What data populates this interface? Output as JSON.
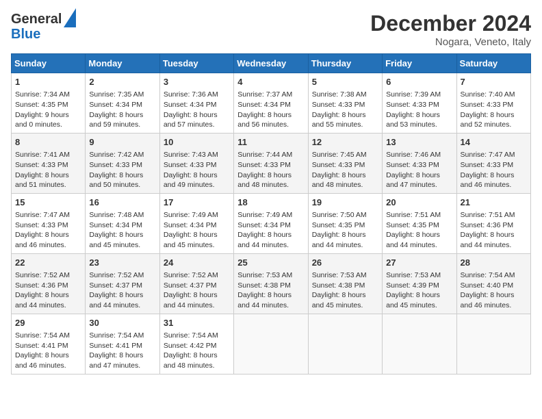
{
  "header": {
    "logo_general": "General",
    "logo_blue": "Blue",
    "month_title": "December 2024",
    "location": "Nogara, Veneto, Italy"
  },
  "days_of_week": [
    "Sunday",
    "Monday",
    "Tuesday",
    "Wednesday",
    "Thursday",
    "Friday",
    "Saturday"
  ],
  "weeks": [
    [
      {
        "day": "1",
        "sunrise": "Sunrise: 7:34 AM",
        "sunset": "Sunset: 4:35 PM",
        "daylight": "Daylight: 9 hours and 0 minutes."
      },
      {
        "day": "2",
        "sunrise": "Sunrise: 7:35 AM",
        "sunset": "Sunset: 4:34 PM",
        "daylight": "Daylight: 8 hours and 59 minutes."
      },
      {
        "day": "3",
        "sunrise": "Sunrise: 7:36 AM",
        "sunset": "Sunset: 4:34 PM",
        "daylight": "Daylight: 8 hours and 57 minutes."
      },
      {
        "day": "4",
        "sunrise": "Sunrise: 7:37 AM",
        "sunset": "Sunset: 4:34 PM",
        "daylight": "Daylight: 8 hours and 56 minutes."
      },
      {
        "day": "5",
        "sunrise": "Sunrise: 7:38 AM",
        "sunset": "Sunset: 4:33 PM",
        "daylight": "Daylight: 8 hours and 55 minutes."
      },
      {
        "day": "6",
        "sunrise": "Sunrise: 7:39 AM",
        "sunset": "Sunset: 4:33 PM",
        "daylight": "Daylight: 8 hours and 53 minutes."
      },
      {
        "day": "7",
        "sunrise": "Sunrise: 7:40 AM",
        "sunset": "Sunset: 4:33 PM",
        "daylight": "Daylight: 8 hours and 52 minutes."
      }
    ],
    [
      {
        "day": "8",
        "sunrise": "Sunrise: 7:41 AM",
        "sunset": "Sunset: 4:33 PM",
        "daylight": "Daylight: 8 hours and 51 minutes."
      },
      {
        "day": "9",
        "sunrise": "Sunrise: 7:42 AM",
        "sunset": "Sunset: 4:33 PM",
        "daylight": "Daylight: 8 hours and 50 minutes."
      },
      {
        "day": "10",
        "sunrise": "Sunrise: 7:43 AM",
        "sunset": "Sunset: 4:33 PM",
        "daylight": "Daylight: 8 hours and 49 minutes."
      },
      {
        "day": "11",
        "sunrise": "Sunrise: 7:44 AM",
        "sunset": "Sunset: 4:33 PM",
        "daylight": "Daylight: 8 hours and 48 minutes."
      },
      {
        "day": "12",
        "sunrise": "Sunrise: 7:45 AM",
        "sunset": "Sunset: 4:33 PM",
        "daylight": "Daylight: 8 hours and 48 minutes."
      },
      {
        "day": "13",
        "sunrise": "Sunrise: 7:46 AM",
        "sunset": "Sunset: 4:33 PM",
        "daylight": "Daylight: 8 hours and 47 minutes."
      },
      {
        "day": "14",
        "sunrise": "Sunrise: 7:47 AM",
        "sunset": "Sunset: 4:33 PM",
        "daylight": "Daylight: 8 hours and 46 minutes."
      }
    ],
    [
      {
        "day": "15",
        "sunrise": "Sunrise: 7:47 AM",
        "sunset": "Sunset: 4:33 PM",
        "daylight": "Daylight: 8 hours and 46 minutes."
      },
      {
        "day": "16",
        "sunrise": "Sunrise: 7:48 AM",
        "sunset": "Sunset: 4:34 PM",
        "daylight": "Daylight: 8 hours and 45 minutes."
      },
      {
        "day": "17",
        "sunrise": "Sunrise: 7:49 AM",
        "sunset": "Sunset: 4:34 PM",
        "daylight": "Daylight: 8 hours and 45 minutes."
      },
      {
        "day": "18",
        "sunrise": "Sunrise: 7:49 AM",
        "sunset": "Sunset: 4:34 PM",
        "daylight": "Daylight: 8 hours and 44 minutes."
      },
      {
        "day": "19",
        "sunrise": "Sunrise: 7:50 AM",
        "sunset": "Sunset: 4:35 PM",
        "daylight": "Daylight: 8 hours and 44 minutes."
      },
      {
        "day": "20",
        "sunrise": "Sunrise: 7:51 AM",
        "sunset": "Sunset: 4:35 PM",
        "daylight": "Daylight: 8 hours and 44 minutes."
      },
      {
        "day": "21",
        "sunrise": "Sunrise: 7:51 AM",
        "sunset": "Sunset: 4:36 PM",
        "daylight": "Daylight: 8 hours and 44 minutes."
      }
    ],
    [
      {
        "day": "22",
        "sunrise": "Sunrise: 7:52 AM",
        "sunset": "Sunset: 4:36 PM",
        "daylight": "Daylight: 8 hours and 44 minutes."
      },
      {
        "day": "23",
        "sunrise": "Sunrise: 7:52 AM",
        "sunset": "Sunset: 4:37 PM",
        "daylight": "Daylight: 8 hours and 44 minutes."
      },
      {
        "day": "24",
        "sunrise": "Sunrise: 7:52 AM",
        "sunset": "Sunset: 4:37 PM",
        "daylight": "Daylight: 8 hours and 44 minutes."
      },
      {
        "day": "25",
        "sunrise": "Sunrise: 7:53 AM",
        "sunset": "Sunset: 4:38 PM",
        "daylight": "Daylight: 8 hours and 44 minutes."
      },
      {
        "day": "26",
        "sunrise": "Sunrise: 7:53 AM",
        "sunset": "Sunset: 4:38 PM",
        "daylight": "Daylight: 8 hours and 45 minutes."
      },
      {
        "day": "27",
        "sunrise": "Sunrise: 7:53 AM",
        "sunset": "Sunset: 4:39 PM",
        "daylight": "Daylight: 8 hours and 45 minutes."
      },
      {
        "day": "28",
        "sunrise": "Sunrise: 7:54 AM",
        "sunset": "Sunset: 4:40 PM",
        "daylight": "Daylight: 8 hours and 46 minutes."
      }
    ],
    [
      {
        "day": "29",
        "sunrise": "Sunrise: 7:54 AM",
        "sunset": "Sunset: 4:41 PM",
        "daylight": "Daylight: 8 hours and 46 minutes."
      },
      {
        "day": "30",
        "sunrise": "Sunrise: 7:54 AM",
        "sunset": "Sunset: 4:41 PM",
        "daylight": "Daylight: 8 hours and 47 minutes."
      },
      {
        "day": "31",
        "sunrise": "Sunrise: 7:54 AM",
        "sunset": "Sunset: 4:42 PM",
        "daylight": "Daylight: 8 hours and 48 minutes."
      },
      null,
      null,
      null,
      null
    ]
  ]
}
